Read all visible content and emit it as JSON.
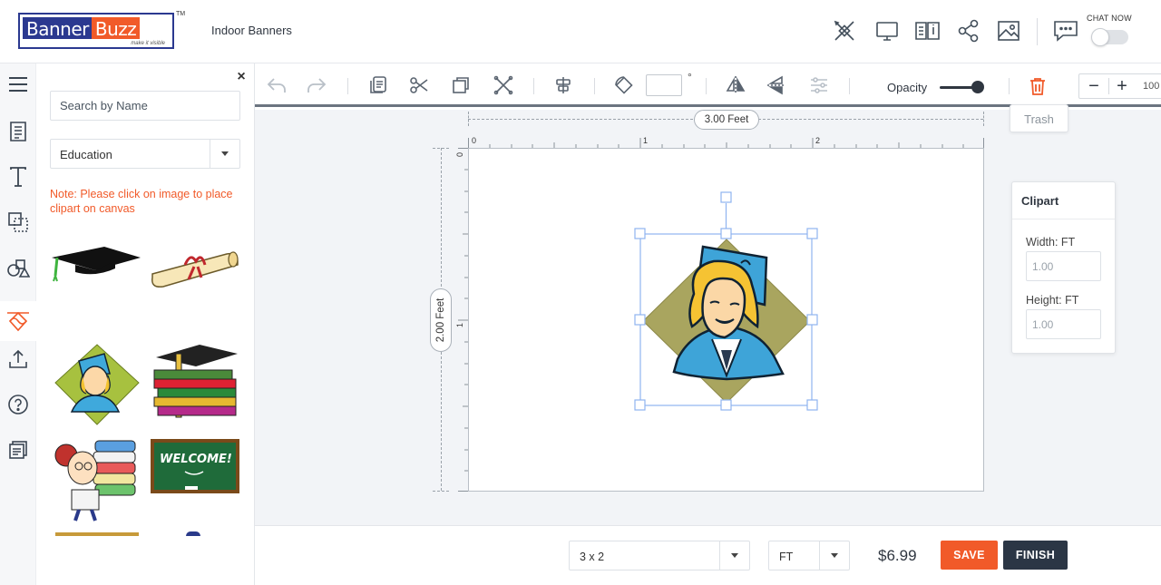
{
  "header": {
    "logo_part1": "Banner",
    "logo_part2": "Buzz",
    "logo_tagline": "make it visible",
    "logo_tm": "TM",
    "page_title": "Indoor Banners",
    "icons": [
      "design-tools-icon",
      "monitor-icon",
      "book-info-icon",
      "share-icon",
      "image-icon",
      "chat-icon"
    ],
    "chat_label": "CHAT NOW"
  },
  "rail": {
    "items": [
      "menu-icon",
      "template-icon",
      "text-icon",
      "background-icon",
      "shapes-icon",
      "clipart-icon",
      "upload-icon",
      "help-icon",
      "notes-icon"
    ],
    "active": "clipart-icon"
  },
  "panel": {
    "search_placeholder": "Search by Name",
    "category": "Education",
    "note": "Note: Please click on image to place clipart on canvas",
    "thumbnails": [
      "graduation-cap",
      "diploma-scroll",
      "graduate-woman",
      "books-with-cap",
      "girl-with-books",
      "welcome-chalkboard"
    ]
  },
  "toolbar": {
    "angle_value": "",
    "degree_symbol": "°",
    "opacity_label": "Opacity",
    "opacity_value": 1.0,
    "zoom_value": "100",
    "trash_tooltip": "Trash"
  },
  "canvas": {
    "width_label": "3.00 Feet",
    "height_label": "2.00 Feet",
    "ruler_h": [
      "0",
      "1",
      "2"
    ],
    "ruler_v": [
      "0",
      "1"
    ]
  },
  "clipart_props": {
    "title": "Clipart",
    "width_label": "Width: FT",
    "width_value": "1.00",
    "height_label": "Height: FT",
    "height_value": "1.00"
  },
  "bottom": {
    "size": "3 x 2",
    "unit": "FT",
    "price": "$6.99",
    "save_label": "SAVE",
    "finish_label": "FINISH"
  },
  "colors": {
    "brand_blue": "#2b3990",
    "brand_orange": "#f15a29",
    "finish_dark": "#2b3645"
  }
}
